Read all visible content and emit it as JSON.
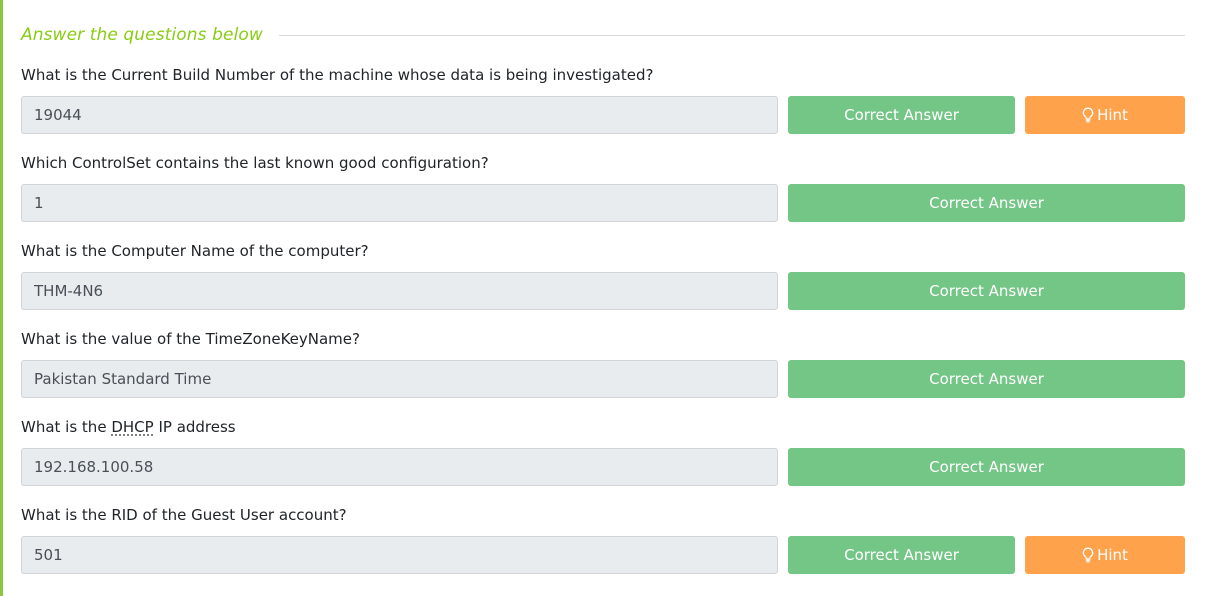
{
  "header": {
    "title": "Answer the questions below"
  },
  "questions": [
    {
      "text": "What is the Current Build Number of the machine whose data is being investigated?",
      "answer": "19044",
      "submit_label": "Correct Answer",
      "hint_label": "Hint"
    },
    {
      "text": "Which ControlSet contains the last known good configuration?",
      "answer": "1",
      "submit_label": "Correct Answer"
    },
    {
      "text": "What is the Computer Name of the computer?",
      "answer": "THM-4N6",
      "submit_label": "Correct Answer"
    },
    {
      "text": "What is the value of the TimeZoneKeyName?",
      "answer": "Pakistan Standard Time",
      "submit_label": "Correct Answer"
    },
    {
      "text_before": "What is the ",
      "text_abbr": "DHCP",
      "text_after": " IP address",
      "answer": "192.168.100.58",
      "submit_label": "Correct Answer"
    },
    {
      "text": "What is the RID of the Guest User account?",
      "answer": "501",
      "submit_label": "Correct Answer",
      "hint_label": "Hint"
    }
  ],
  "colors": {
    "accent": "#88cc14",
    "correct_button": "#74c686",
    "hint_button": "#ffa24c",
    "input_background": "#e9ecef"
  },
  "icons": {
    "hint": "lightbulb-icon"
  }
}
